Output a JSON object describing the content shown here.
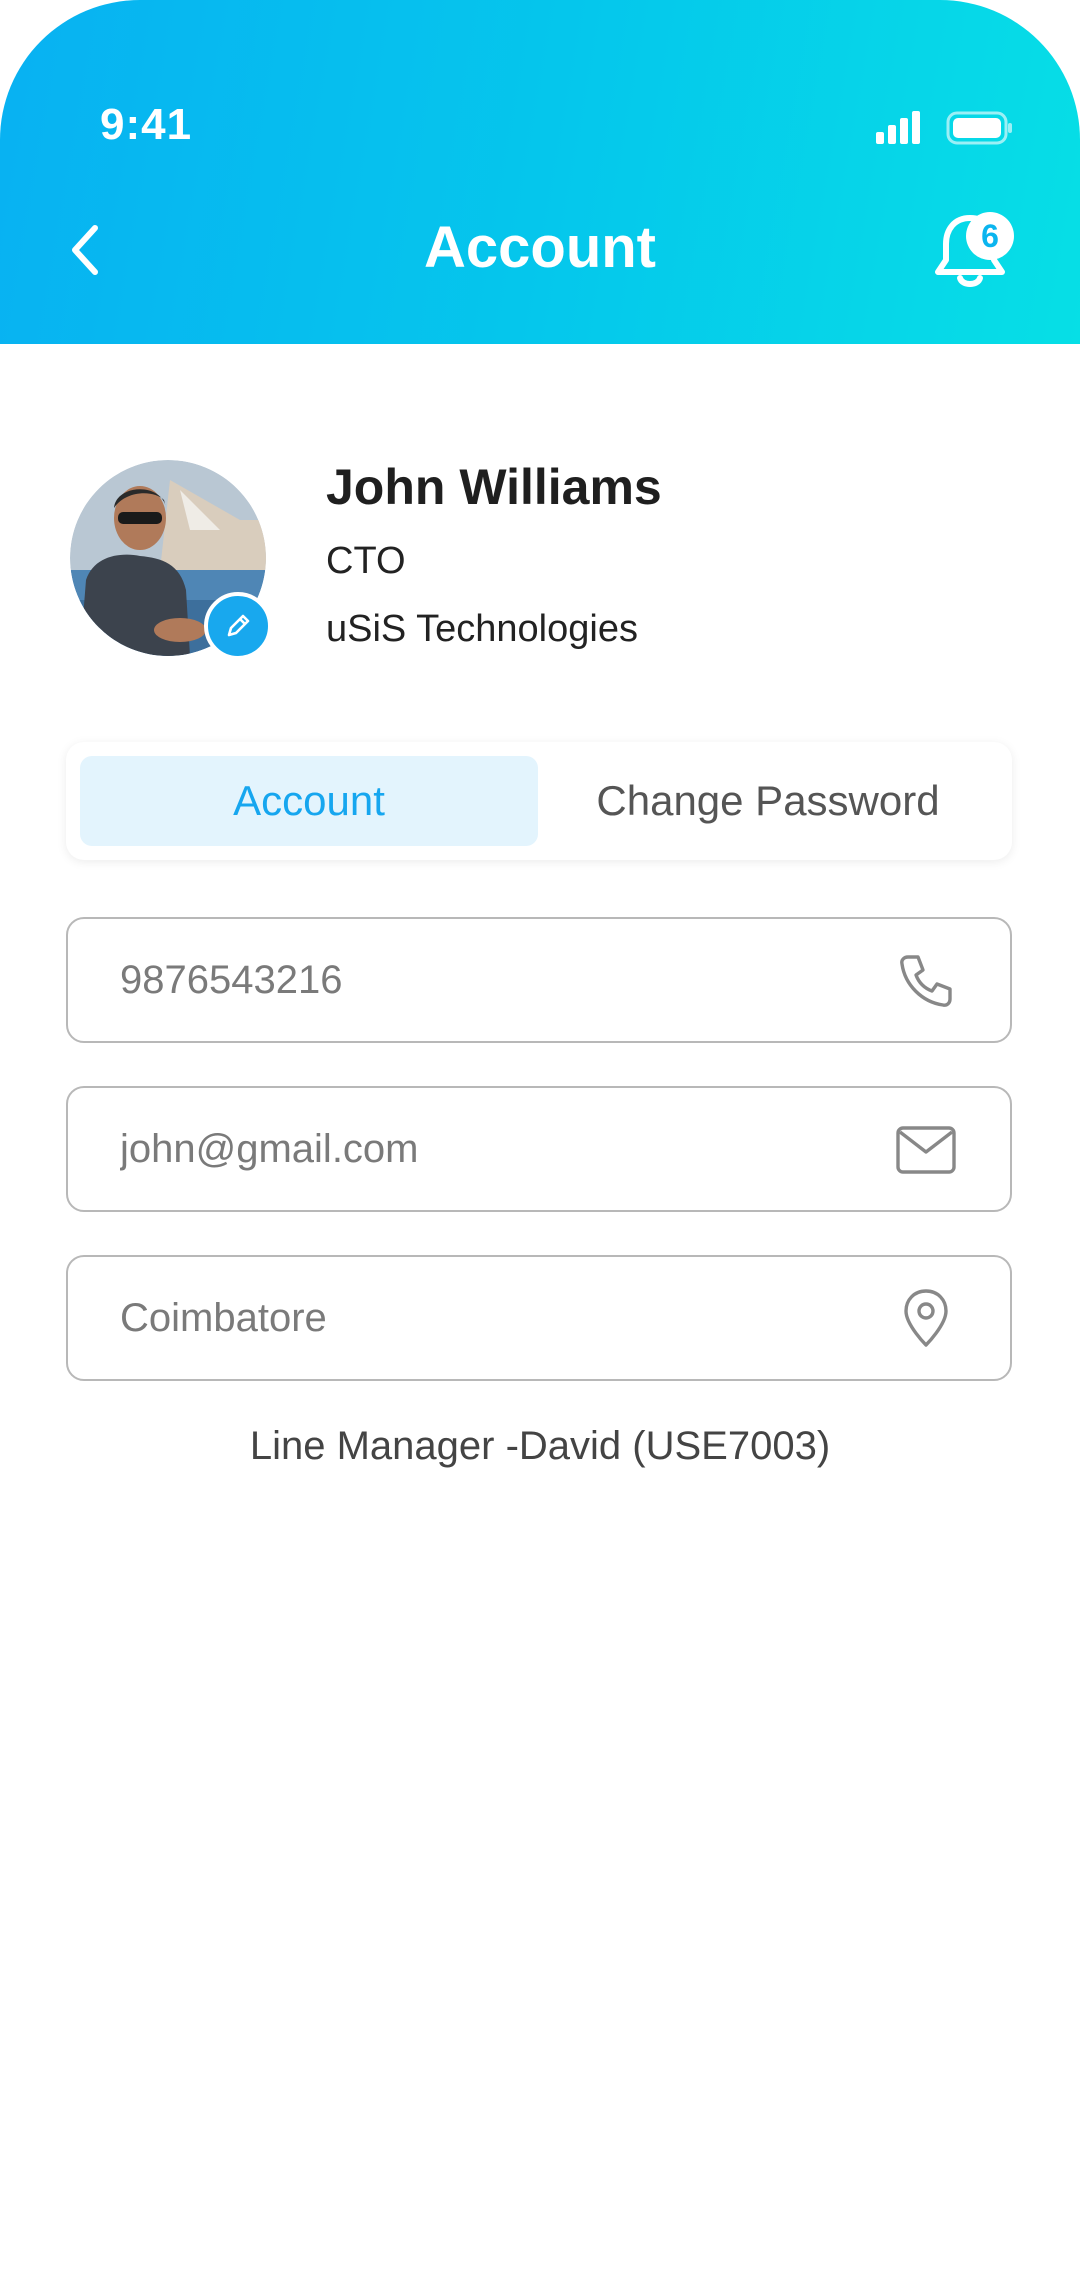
{
  "status_bar": {
    "time": "9:41",
    "signal_icon": "signal-bars-icon",
    "battery_icon": "battery-icon"
  },
  "header": {
    "title": "Account",
    "back_icon": "chevron-left-icon",
    "notification_icon": "bell-icon",
    "notification_count": "6",
    "gradient_colors": [
      "#08b1f2",
      "#06dfe6"
    ]
  },
  "profile": {
    "name": "John Williams",
    "role": "CTO",
    "company": "uSiS Technologies",
    "edit_icon": "pencil-icon"
  },
  "tabs": [
    {
      "label": "Account",
      "active": true
    },
    {
      "label": "Change Password",
      "active": false
    }
  ],
  "fields": {
    "phone": {
      "value": "9876543216",
      "icon": "phone-icon"
    },
    "email": {
      "value": "john@gmail.com",
      "icon": "mail-icon"
    },
    "location": {
      "value": "Coimbatore",
      "icon": "location-pin-icon"
    }
  },
  "line_manager": "Line Manager -David (USE7003)",
  "colors": {
    "accent": "#16a6ef",
    "active_tab_bg": "#e3f4fd",
    "field_border": "#b8b8b8"
  }
}
